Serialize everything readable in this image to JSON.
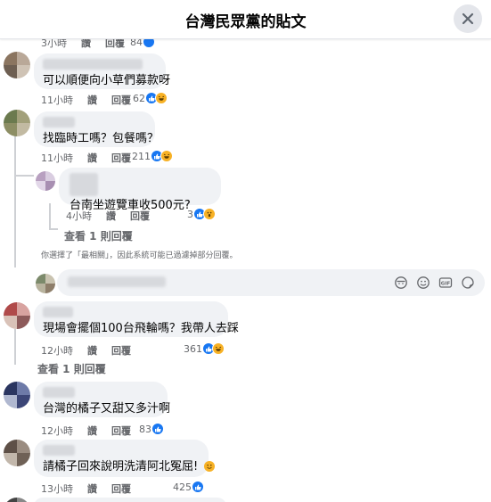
{
  "header": {
    "title": "台灣民眾黨的貼文"
  },
  "top_partial": {
    "time": "3小時",
    "like": "讚",
    "reply": "回覆",
    "count": "84"
  },
  "comments": [
    {
      "text": "可以順便向小草們募款呀",
      "time": "11小時",
      "like": "讚",
      "reply": "回覆",
      "reaction_count": "62"
    },
    {
      "text": "找臨時工嗎？包餐嗎？",
      "time": "11小時",
      "like": "讚",
      "reply": "回覆",
      "reaction_count": "211"
    },
    {
      "text": "台南坐遊覽車收500元?",
      "time": "4小時",
      "like": "讚",
      "reply": "回覆",
      "reaction_count": "3"
    },
    {
      "text": "現場會擺個100台飛輪嗎？我帶人去踩",
      "time": "12小時",
      "like": "讚",
      "reply": "回覆",
      "reaction_count": "361"
    },
    {
      "text": "台灣的橘子又甜又多汁啊",
      "time": "12小時",
      "like": "讚",
      "reply": "回覆",
      "reaction_count": "83"
    },
    {
      "text": "請橘子回來說明洗清阿北冤屈!",
      "time": "13小時",
      "like": "讚",
      "reply": "回覆",
      "reaction_count": "425"
    }
  ],
  "view_replies_1": "查看 1 則回覆",
  "view_replies_2": "查看 1 則回覆",
  "filter_note": "你選擇了「最相關」，因此系統可能已過濾掉部分回覆。",
  "colors": {
    "like_blue": "#1877f2",
    "haha_yellow": "#f7b125",
    "love_red": "#f33e58"
  },
  "icons": [
    "close-icon",
    "like-reaction-icon",
    "haha-reaction-icon",
    "wow-reaction-icon",
    "emoji-icon",
    "sticker-icon",
    "gif-icon",
    "camera-icon"
  ]
}
